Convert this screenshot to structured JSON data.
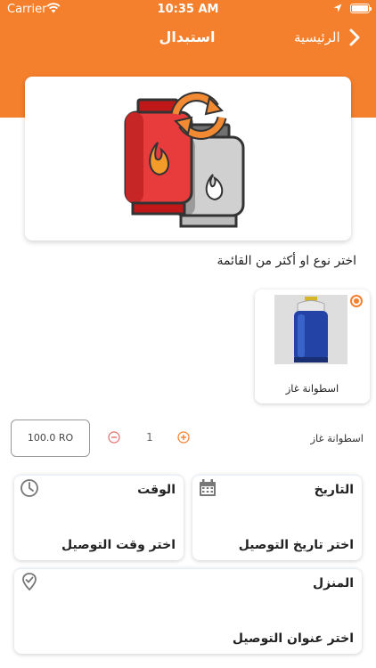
{
  "status_bar": {
    "carrier": "Carrier",
    "time": "10:35 AM",
    "icons": [
      "wifi-icon",
      "location-arrow-icon",
      "battery-icon"
    ]
  },
  "header": {
    "title": "استبدال",
    "back_label": "الرئيسية",
    "background_color": "#f47f2c"
  },
  "hero": {
    "image": "gas-cylinder-exchange-illustration"
  },
  "instruction": "اختر نوع او أكثر من القائمة",
  "products": [
    {
      "name": "اسطوانة غاز",
      "selected": true,
      "image": "blue-gas-cylinder-photo"
    }
  ],
  "order_line": {
    "item_name": "اسطوانة غاز",
    "quantity": "1",
    "price": "100.0 RO"
  },
  "fields": {
    "date": {
      "label": "التاريخ",
      "value": "اختر تاريخ التوصيل",
      "icon": "calendar-icon"
    },
    "time": {
      "label": "الوقت",
      "value": "اختر وقت التوصيل",
      "icon": "clock-icon"
    },
    "address": {
      "label": "المنزل",
      "value": "اختر عنوان التوصيل",
      "icon": "location-check-icon"
    }
  },
  "accent_color": "#f47f2c"
}
